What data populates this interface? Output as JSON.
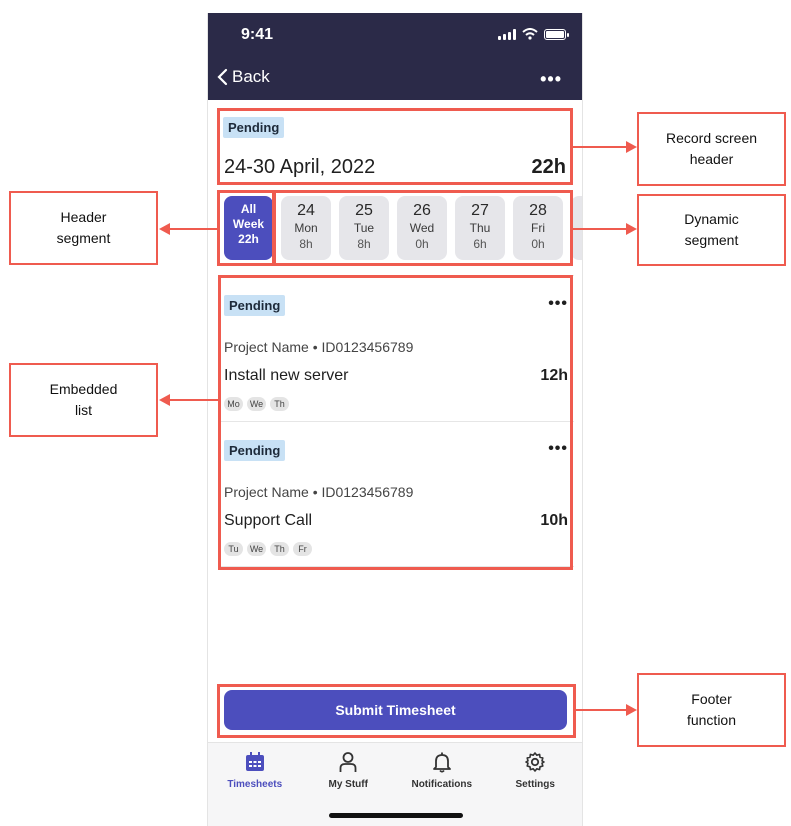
{
  "status_bar": {
    "time": "9:41"
  },
  "nav": {
    "back_label": "Back",
    "more_label": "•••"
  },
  "record_header": {
    "status": "Pending",
    "title": "24-30 April, 2022",
    "total": "22h"
  },
  "segments": {
    "all": {
      "line1": "All",
      "line2": "Week",
      "line3": "22h"
    },
    "days": [
      {
        "date": "24",
        "weekday": "Mon",
        "hours": "8h"
      },
      {
        "date": "25",
        "weekday": "Tue",
        "hours": "8h"
      },
      {
        "date": "26",
        "weekday": "Wed",
        "hours": "0h"
      },
      {
        "date": "27",
        "weekday": "Thu",
        "hours": "6h"
      },
      {
        "date": "28",
        "weekday": "Fri",
        "hours": "0h"
      }
    ]
  },
  "entries": [
    {
      "status": "Pending",
      "more": "•••",
      "project": "Project Name • ID0123456789",
      "task": "Install new server",
      "hours": "12h",
      "days": [
        "Mo",
        "We",
        "Th"
      ]
    },
    {
      "status": "Pending",
      "more": "•••",
      "project": "Project Name • ID0123456789",
      "task": "Support Call",
      "hours": "10h",
      "days": [
        "Tu",
        "We",
        "Th",
        "Fr"
      ]
    }
  ],
  "footer": {
    "submit_label": "Submit Timesheet"
  },
  "tabs": [
    {
      "label": "Timesheets",
      "icon": "calendar-icon"
    },
    {
      "label": "My Stuff",
      "icon": "person-icon"
    },
    {
      "label": "Notifications",
      "icon": "bell-icon"
    },
    {
      "label": "Settings",
      "icon": "gear-icon"
    }
  ],
  "annotations": {
    "record_screen_header": "Record screen header",
    "header_segment": "Header segment",
    "dynamic_segment": "Dynamic segment",
    "embedded_list": "Embedded list",
    "footer_function": "Footer function"
  },
  "colors": {
    "accent": "#4c4ebd",
    "topbar": "#2b2a48",
    "annotation": "#ef5b4f",
    "badge": "#c8e1f5"
  }
}
